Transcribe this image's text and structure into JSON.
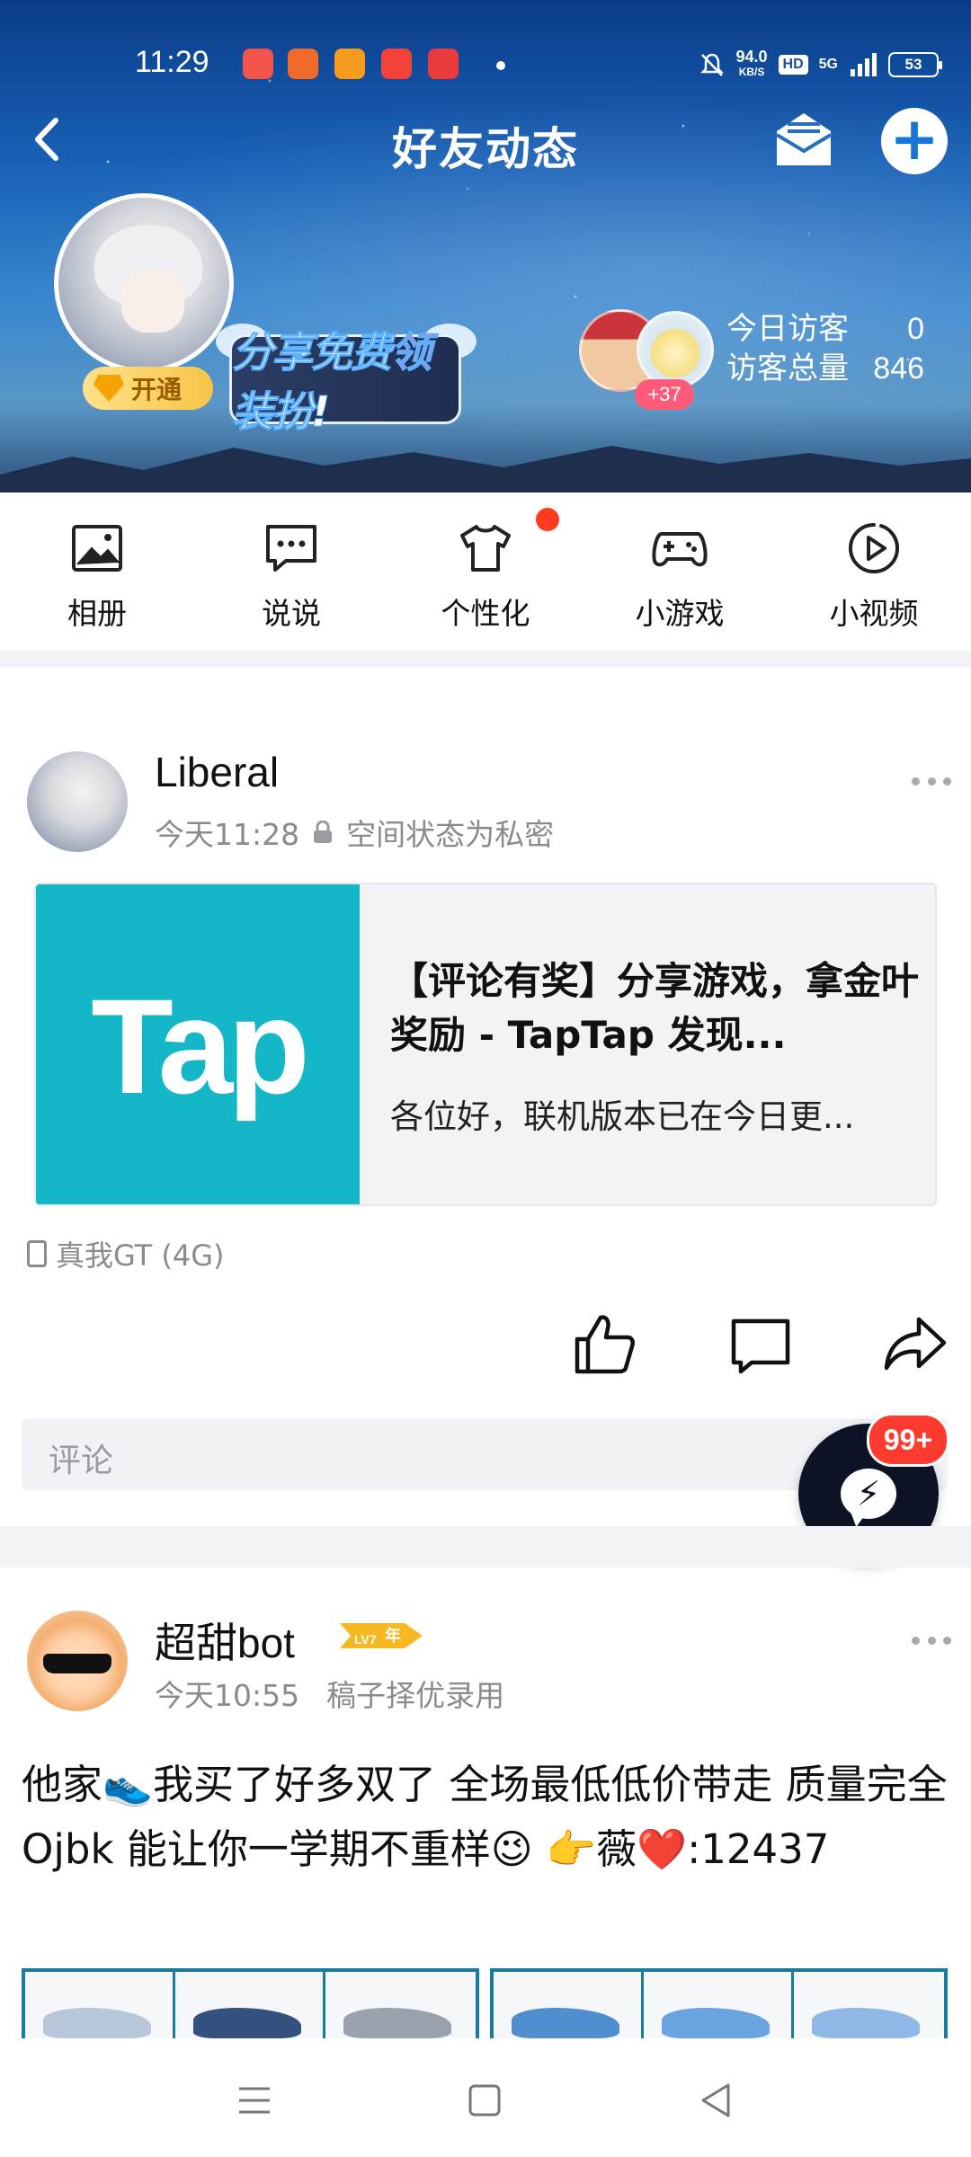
{
  "status_bar": {
    "time": "11:29",
    "net_speed_value": "94.0",
    "net_speed_unit": "KB/S",
    "hd_label": "HD",
    "signal_label": "5G",
    "battery": "53"
  },
  "header": {
    "title": "好友动态",
    "vip_label": "开通",
    "promo_text_pre": "分享免费",
    "promo_text_highlight": "领",
    "promo_text_post": "装扮!",
    "visitors_extra": "+37",
    "today_visitors_label": "今日访客",
    "today_visitors_value": "0",
    "total_visitors_label": "访客总量",
    "total_visitors_value": "846"
  },
  "nav": {
    "items": [
      {
        "label": "相册",
        "icon": "photo-album-icon"
      },
      {
        "label": "说说",
        "icon": "chat-bubble-icon"
      },
      {
        "label": "个性化",
        "icon": "tshirt-icon"
      },
      {
        "label": "小游戏",
        "icon": "gamepad-icon"
      },
      {
        "label": "小视频",
        "icon": "play-circle-icon"
      }
    ]
  },
  "post1": {
    "username": "Liberal",
    "time": "今天11:28",
    "privacy": "空间状态为私密",
    "card": {
      "thumb_text": "Tap",
      "title": "【评论有奖】分享游戏，拿金叶奖励 - TapTap 发现...",
      "desc": "各位好，联机版本已在今日更..."
    },
    "device": "真我GT (4G)",
    "comment_placeholder": "评论"
  },
  "fab": {
    "badge": "99+"
  },
  "post2": {
    "username": "超甜bot",
    "level_badge": "LV7",
    "year_badge": "年",
    "time": "今天10:55",
    "tag": "稿子择优录用",
    "text": "他家👟我买了好多双了 全场最低低价带走 质量完全Ojbk 能让你一学期不重样😉 👉薇❤️:12437"
  },
  "colors": {
    "accent": "#1676d6",
    "red_dot": "#ff3b1f",
    "tap_bg": "#14b7c8",
    "fab_bg": "#0d1224",
    "badge_red": "#ff3b30"
  }
}
